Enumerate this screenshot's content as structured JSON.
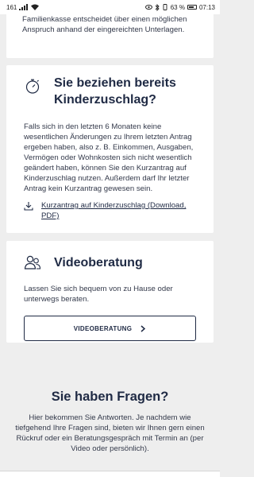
{
  "status_bar": {
    "left_text": "161",
    "battery": "63 %",
    "time": "07:13"
  },
  "card_partial": {
    "text": "Familienkasse entscheidet über einen möglichen Anspruch anhand der eingereichten Unterlagen."
  },
  "card_kinderzuschlag": {
    "icon": "stopwatch-icon",
    "title": "Sie beziehen bereits Kinderzuschlag?",
    "text": "Falls sich in den letzten 6 Monaten keine wesentlichen Änderungen zu Ihrem letzten Antrag ergeben haben, also z. B. Einkommen, Ausgaben, Vermögen oder Wohnkosten sich nicht wesentlich geändert haben, können Sie den Kurzantrag auf Kinderzuschlag nutzen. Außerdem darf Ihr letzter Antrag kein Kurzantrag gewesen sein.",
    "download_icon": "download-icon",
    "download_label": "Kurzantrag auf Kinderzuschlag (Download, PDF)"
  },
  "card_video": {
    "icon": "people-icon",
    "title": "Videoberatung",
    "text": "Lassen Sie sich bequem von zu Hause oder unterwegs beraten.",
    "button_label": "VIDEOBERATUNG"
  },
  "faq": {
    "title": "Sie haben Fragen?",
    "text": "Hier bekommen Sie Antworten. Je nachdem wie tiefgehend Ihre Fragen sind, bieten wir Ihnen gern einen Rückruf oder ein Beratungsgespräch mit Termin an (per Video oder persönlich)."
  },
  "colors": {
    "text_dark": "#1f2a44",
    "background": "#eeeeee",
    "card": "#ffffff"
  }
}
